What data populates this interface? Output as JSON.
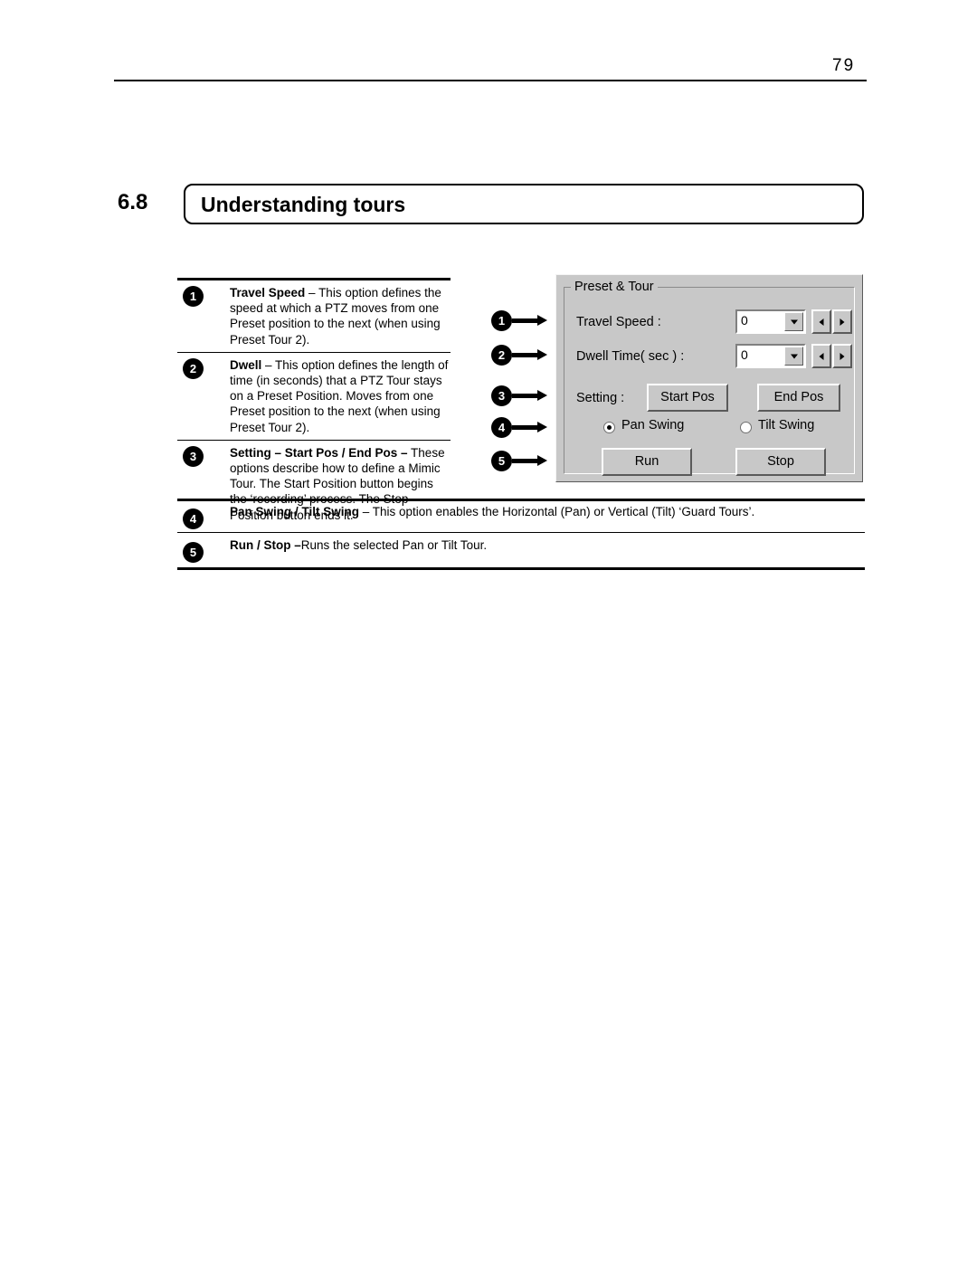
{
  "page": {
    "number": "79"
  },
  "section": {
    "number": "6.8",
    "title": "Understanding tours"
  },
  "legend": {
    "items": [
      {
        "marker": "1",
        "bold": "Travel Speed",
        "text": " – This option defines the speed at which a PTZ moves from one Preset position to the next (when using Preset Tour 2)."
      },
      {
        "marker": "2",
        "bold": "Dwell",
        "text": " – This option defines the length of time (in seconds) that a PTZ Tour stays on a Preset Position. Moves from one Preset position to the next (when using Preset Tour 2)."
      },
      {
        "marker": "3",
        "bold": "Setting – Start Pos / End Pos –",
        "text": " These options describe how to define a Mimic Tour. The Start Position button begins the ‘recording’ process. The Stop Position button ends it."
      },
      {
        "marker": "4",
        "bold": "Pan Swing / Tilt Swing",
        "text": " – This option enables the Horizontal (Pan) or Vertical (Tilt) ‘Guard Tours’."
      },
      {
        "marker": "5",
        "bold": "Run / Stop –",
        "text": "Runs the selected Pan or Tilt Tour."
      }
    ]
  },
  "dialog": {
    "group_title": "Preset & Tour",
    "travel_speed_label": "Travel Speed  :",
    "travel_speed_value": "0",
    "dwell_time_label": "Dwell Time( sec )  :",
    "dwell_time_value": "0",
    "setting_label": "Setting  :",
    "start_pos_button": "Start Pos",
    "end_pos_button": "End Pos",
    "pan_swing_label": "Pan Swing",
    "tilt_swing_label": "Tilt Swing",
    "run_button": "Run",
    "stop_button": "Stop"
  },
  "callouts": {
    "c1": "1",
    "c2": "2",
    "c3": "3",
    "c4": "4",
    "c5": "5"
  }
}
